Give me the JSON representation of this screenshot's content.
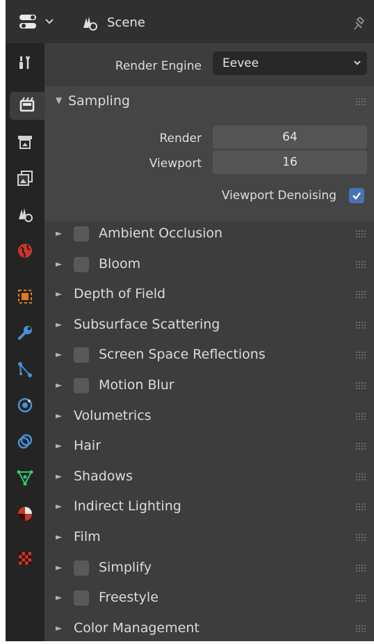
{
  "header": {
    "title": "Scene",
    "editor_icon": "properties-editor-icon",
    "scene_icon": "scene-icon",
    "pin_icon": "pin-icon"
  },
  "tabs": [
    {
      "name": "tool",
      "icon": "tool-icon"
    },
    {
      "name": "render",
      "icon": "render-icon",
      "active": true
    },
    {
      "name": "output",
      "icon": "output-icon"
    },
    {
      "name": "view-layer",
      "icon": "view-layer-icon"
    },
    {
      "name": "scene",
      "icon": "scene-icon"
    },
    {
      "name": "world",
      "icon": "world-icon"
    },
    {
      "name": "object",
      "icon": "object-icon"
    },
    {
      "name": "modifiers",
      "icon": "wrench-icon"
    },
    {
      "name": "particles",
      "icon": "particles-icon"
    },
    {
      "name": "physics",
      "icon": "physics-icon"
    },
    {
      "name": "constraints",
      "icon": "constraints-icon"
    },
    {
      "name": "data",
      "icon": "mesh-data-icon"
    },
    {
      "name": "material",
      "icon": "material-icon"
    },
    {
      "name": "texture",
      "icon": "texture-icon"
    }
  ],
  "render_engine": {
    "label": "Render Engine",
    "value": "Eevee"
  },
  "sampling": {
    "title": "Sampling",
    "render_label": "Render",
    "render_value": "64",
    "viewport_label": "Viewport",
    "viewport_value": "16",
    "denoise_label": "Viewport Denoising",
    "denoise_checked": true
  },
  "sections": [
    {
      "title": "Ambient Occlusion",
      "checkbox": true
    },
    {
      "title": "Bloom",
      "checkbox": true
    },
    {
      "title": "Depth of Field",
      "checkbox": false
    },
    {
      "title": "Subsurface Scattering",
      "checkbox": false
    },
    {
      "title": "Screen Space Reflections",
      "checkbox": true
    },
    {
      "title": "Motion Blur",
      "checkbox": true
    },
    {
      "title": "Volumetrics",
      "checkbox": false
    },
    {
      "title": "Hair",
      "checkbox": false
    },
    {
      "title": "Shadows",
      "checkbox": false
    },
    {
      "title": "Indirect Lighting",
      "checkbox": false
    },
    {
      "title": "Film",
      "checkbox": false
    },
    {
      "title": "Simplify",
      "checkbox": true
    },
    {
      "title": "Freestyle",
      "checkbox": true
    },
    {
      "title": "Color Management",
      "checkbox": false
    }
  ],
  "colors": {
    "panel_bg": "#3d3d3d",
    "header_bg": "#303030",
    "tabs_bg": "#242424",
    "accent": "#4772b3"
  }
}
